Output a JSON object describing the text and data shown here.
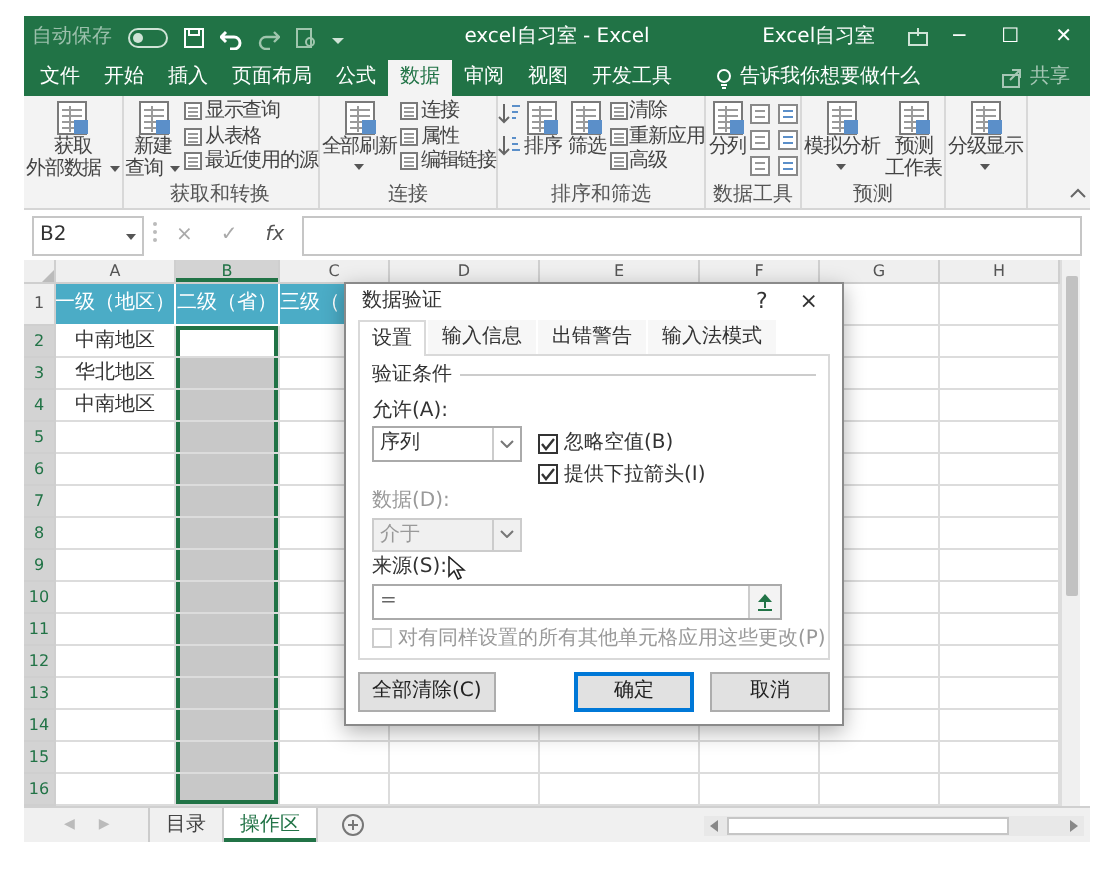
{
  "title_bar": {
    "autosave_label": "自动保存",
    "autosave_on": false,
    "title": "excel自习室 - Excel",
    "account": "Excel自习室",
    "window_buttons": [
      "─",
      "☐",
      "✕"
    ]
  },
  "ribbon_tabs": [
    {
      "label": "文件",
      "selected": false
    },
    {
      "label": "开始",
      "selected": false
    },
    {
      "label": "插入",
      "selected": false
    },
    {
      "label": "页面布局",
      "selected": false
    },
    {
      "label": "公式",
      "selected": false
    },
    {
      "label": "数据",
      "selected": true
    },
    {
      "label": "审阅",
      "selected": false
    },
    {
      "label": "视图",
      "selected": false
    },
    {
      "label": "开发工具",
      "selected": false
    }
  ],
  "tell_me": "告诉我你想要做什么",
  "share": "共享",
  "ribbon_groups": [
    {
      "buttons": [
        {
          "kind": "large",
          "lines": [
            "获取",
            "外部数据"
          ],
          "dropdown": true
        }
      ]
    },
    {
      "label": "获取和转换",
      "buttons": [
        {
          "kind": "large",
          "lines": [
            "新建",
            "查询"
          ],
          "dropdown": true
        },
        {
          "kind": "stack",
          "items": [
            "显示查询",
            "从表格",
            "最近使用的源"
          ]
        }
      ]
    },
    {
      "label": "连接",
      "buttons": [
        {
          "kind": "large",
          "lines": [
            "全部刷新"
          ],
          "dropdown": true
        },
        {
          "kind": "stack",
          "items": [
            "连接",
            "属性",
            "编辑链接"
          ]
        }
      ]
    },
    {
      "label": "排序和筛选",
      "buttons": [
        {
          "kind": "sort_icons"
        },
        {
          "kind": "large",
          "lines": [
            "排序"
          ],
          "dropdown": false
        },
        {
          "kind": "large",
          "lines": [
            "筛选"
          ],
          "dropdown": false
        },
        {
          "kind": "stack",
          "items": [
            "清除",
            "重新应用",
            "高级"
          ]
        }
      ]
    },
    {
      "label": "数据工具",
      "buttons": [
        {
          "kind": "large",
          "lines": [
            "分列"
          ],
          "dropdown": false
        },
        {
          "kind": "tool_icons"
        }
      ]
    },
    {
      "label": "预测",
      "buttons": [
        {
          "kind": "large",
          "lines": [
            "模拟分析"
          ],
          "dropdown": true
        },
        {
          "kind": "large",
          "lines": [
            "预测",
            "工作表"
          ],
          "dropdown": false
        }
      ]
    },
    {
      "buttons": [
        {
          "kind": "large",
          "lines": [
            "分级显示"
          ],
          "dropdown": true
        }
      ]
    }
  ],
  "formula_bar": {
    "name_box": "B2",
    "cancel": "×",
    "enter": "✓",
    "function": "fx"
  },
  "columns": [
    {
      "label": "A",
      "selected": false
    },
    {
      "label": "B",
      "selected": true
    },
    {
      "label": "C",
      "selected": false
    },
    {
      "label": "D",
      "selected": false
    },
    {
      "label": "E",
      "selected": false
    },
    {
      "label": "F",
      "selected": false
    },
    {
      "label": "G",
      "selected": false
    },
    {
      "label": "H",
      "selected": false
    }
  ],
  "rows": [
    {
      "number": "1",
      "kind": "header",
      "selected": false,
      "cells": [
        "一级（地区）",
        "二级（省）",
        "三级（"
      ]
    },
    {
      "number": "2",
      "kind": "data",
      "selected": true,
      "cells": [
        "中南地区"
      ]
    },
    {
      "number": "3",
      "kind": "data",
      "selected": true,
      "cells": [
        "华北地区"
      ]
    },
    {
      "number": "4",
      "kind": "data",
      "selected": true,
      "cells": [
        "中南地区"
      ]
    },
    {
      "number": "5",
      "kind": "data",
      "selected": true
    },
    {
      "number": "6",
      "kind": "data",
      "selected": true
    },
    {
      "number": "7",
      "kind": "data",
      "selected": true
    },
    {
      "number": "8",
      "kind": "data",
      "selected": true
    },
    {
      "number": "9",
      "kind": "data",
      "selected": true
    },
    {
      "number": "10",
      "kind": "data",
      "selected": true
    },
    {
      "number": "11",
      "kind": "data",
      "selected": true
    },
    {
      "number": "12",
      "kind": "data",
      "selected": true
    },
    {
      "number": "13",
      "kind": "data",
      "selected": true
    },
    {
      "number": "14",
      "kind": "data",
      "selected": true
    },
    {
      "number": "15",
      "kind": "data",
      "selected": true
    },
    {
      "number": "16",
      "kind": "data",
      "selected": true
    }
  ],
  "dialog": {
    "title": "数据验证",
    "help": "?",
    "close": "×",
    "tabs": [
      {
        "label": "设置",
        "selected": true
      },
      {
        "label": "输入信息",
        "selected": false
      },
      {
        "label": "出错警告",
        "selected": false
      },
      {
        "label": "输入法模式",
        "selected": false
      }
    ],
    "section": "验证条件",
    "allow_label": "允许(A):",
    "allow_value": "序列",
    "ignore_blank": {
      "label": "忽略空值(B)",
      "checked": true
    },
    "in_cell_dropdown": {
      "label": "提供下拉箭头(I)",
      "checked": true
    },
    "data_label": "数据(D):",
    "data_value": "介于",
    "data_disabled": true,
    "source_label": "来源(S):",
    "source_value": "=",
    "apply_all": {
      "label": "对有同样设置的所有其他单元格应用这些更改(P)",
      "checked": false,
      "disabled": true
    },
    "buttons": [
      {
        "label": "全部清除(C)",
        "kind": "normal"
      },
      {
        "label": "确定",
        "kind": "default"
      },
      {
        "label": "取消",
        "kind": "normal"
      }
    ]
  },
  "sheet_nav": [
    "◀",
    "▶"
  ],
  "sheet_tabs": [
    {
      "label": "目录",
      "selected": false
    },
    {
      "label": "操作区",
      "selected": true
    }
  ]
}
